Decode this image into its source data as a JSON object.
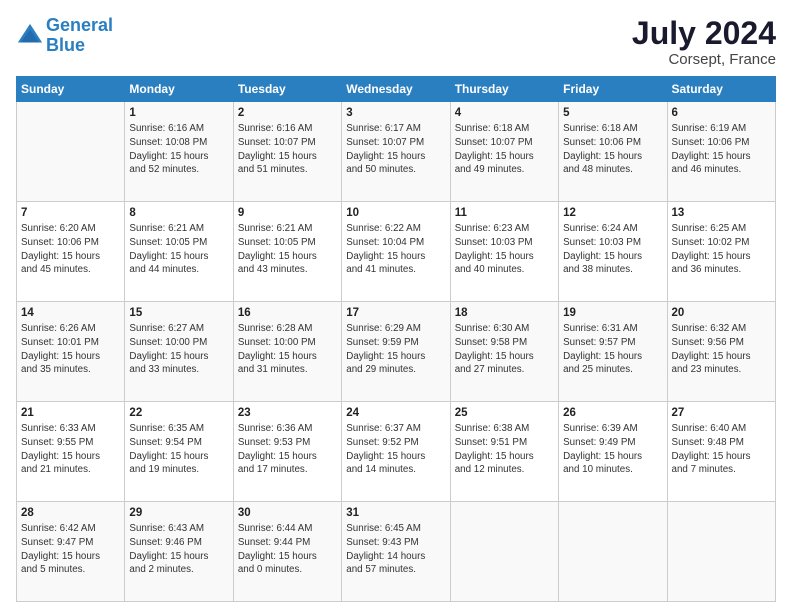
{
  "header": {
    "logo_line1": "General",
    "logo_line2": "Blue",
    "main_title": "July 2024",
    "subtitle": "Corsept, France"
  },
  "days_of_week": [
    "Sunday",
    "Monday",
    "Tuesday",
    "Wednesday",
    "Thursday",
    "Friday",
    "Saturday"
  ],
  "weeks": [
    [
      {
        "num": "",
        "info": ""
      },
      {
        "num": "1",
        "info": "Sunrise: 6:16 AM\nSunset: 10:08 PM\nDaylight: 15 hours\nand 52 minutes."
      },
      {
        "num": "2",
        "info": "Sunrise: 6:16 AM\nSunset: 10:07 PM\nDaylight: 15 hours\nand 51 minutes."
      },
      {
        "num": "3",
        "info": "Sunrise: 6:17 AM\nSunset: 10:07 PM\nDaylight: 15 hours\nand 50 minutes."
      },
      {
        "num": "4",
        "info": "Sunrise: 6:18 AM\nSunset: 10:07 PM\nDaylight: 15 hours\nand 49 minutes."
      },
      {
        "num": "5",
        "info": "Sunrise: 6:18 AM\nSunset: 10:06 PM\nDaylight: 15 hours\nand 48 minutes."
      },
      {
        "num": "6",
        "info": "Sunrise: 6:19 AM\nSunset: 10:06 PM\nDaylight: 15 hours\nand 46 minutes."
      }
    ],
    [
      {
        "num": "7",
        "info": "Sunrise: 6:20 AM\nSunset: 10:06 PM\nDaylight: 15 hours\nand 45 minutes."
      },
      {
        "num": "8",
        "info": "Sunrise: 6:21 AM\nSunset: 10:05 PM\nDaylight: 15 hours\nand 44 minutes."
      },
      {
        "num": "9",
        "info": "Sunrise: 6:21 AM\nSunset: 10:05 PM\nDaylight: 15 hours\nand 43 minutes."
      },
      {
        "num": "10",
        "info": "Sunrise: 6:22 AM\nSunset: 10:04 PM\nDaylight: 15 hours\nand 41 minutes."
      },
      {
        "num": "11",
        "info": "Sunrise: 6:23 AM\nSunset: 10:03 PM\nDaylight: 15 hours\nand 40 minutes."
      },
      {
        "num": "12",
        "info": "Sunrise: 6:24 AM\nSunset: 10:03 PM\nDaylight: 15 hours\nand 38 minutes."
      },
      {
        "num": "13",
        "info": "Sunrise: 6:25 AM\nSunset: 10:02 PM\nDaylight: 15 hours\nand 36 minutes."
      }
    ],
    [
      {
        "num": "14",
        "info": "Sunrise: 6:26 AM\nSunset: 10:01 PM\nDaylight: 15 hours\nand 35 minutes."
      },
      {
        "num": "15",
        "info": "Sunrise: 6:27 AM\nSunset: 10:00 PM\nDaylight: 15 hours\nand 33 minutes."
      },
      {
        "num": "16",
        "info": "Sunrise: 6:28 AM\nSunset: 10:00 PM\nDaylight: 15 hours\nand 31 minutes."
      },
      {
        "num": "17",
        "info": "Sunrise: 6:29 AM\nSunset: 9:59 PM\nDaylight: 15 hours\nand 29 minutes."
      },
      {
        "num": "18",
        "info": "Sunrise: 6:30 AM\nSunset: 9:58 PM\nDaylight: 15 hours\nand 27 minutes."
      },
      {
        "num": "19",
        "info": "Sunrise: 6:31 AM\nSunset: 9:57 PM\nDaylight: 15 hours\nand 25 minutes."
      },
      {
        "num": "20",
        "info": "Sunrise: 6:32 AM\nSunset: 9:56 PM\nDaylight: 15 hours\nand 23 minutes."
      }
    ],
    [
      {
        "num": "21",
        "info": "Sunrise: 6:33 AM\nSunset: 9:55 PM\nDaylight: 15 hours\nand 21 minutes."
      },
      {
        "num": "22",
        "info": "Sunrise: 6:35 AM\nSunset: 9:54 PM\nDaylight: 15 hours\nand 19 minutes."
      },
      {
        "num": "23",
        "info": "Sunrise: 6:36 AM\nSunset: 9:53 PM\nDaylight: 15 hours\nand 17 minutes."
      },
      {
        "num": "24",
        "info": "Sunrise: 6:37 AM\nSunset: 9:52 PM\nDaylight: 15 hours\nand 14 minutes."
      },
      {
        "num": "25",
        "info": "Sunrise: 6:38 AM\nSunset: 9:51 PM\nDaylight: 15 hours\nand 12 minutes."
      },
      {
        "num": "26",
        "info": "Sunrise: 6:39 AM\nSunset: 9:49 PM\nDaylight: 15 hours\nand 10 minutes."
      },
      {
        "num": "27",
        "info": "Sunrise: 6:40 AM\nSunset: 9:48 PM\nDaylight: 15 hours\nand 7 minutes."
      }
    ],
    [
      {
        "num": "28",
        "info": "Sunrise: 6:42 AM\nSunset: 9:47 PM\nDaylight: 15 hours\nand 5 minutes."
      },
      {
        "num": "29",
        "info": "Sunrise: 6:43 AM\nSunset: 9:46 PM\nDaylight: 15 hours\nand 2 minutes."
      },
      {
        "num": "30",
        "info": "Sunrise: 6:44 AM\nSunset: 9:44 PM\nDaylight: 15 hours\nand 0 minutes."
      },
      {
        "num": "31",
        "info": "Sunrise: 6:45 AM\nSunset: 9:43 PM\nDaylight: 14 hours\nand 57 minutes."
      },
      {
        "num": "",
        "info": ""
      },
      {
        "num": "",
        "info": ""
      },
      {
        "num": "",
        "info": ""
      }
    ]
  ]
}
